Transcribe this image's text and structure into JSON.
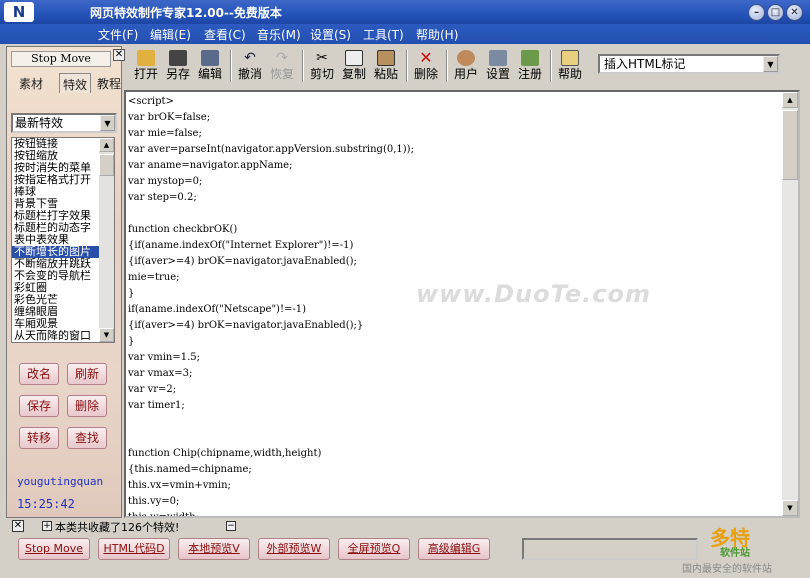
{
  "window": {
    "title": "网页特效制作专家12.00--免费版本",
    "logo": "N"
  },
  "menu": [
    "文件(F)",
    "编辑(E)",
    "查看(C)",
    "音乐(M)",
    "设置(S)",
    "工具(T)",
    "帮助(H)"
  ],
  "left": {
    "stop_move": "Stop Move",
    "tabs": [
      "素材",
      "特效",
      "教程"
    ],
    "category": "最新特效",
    "items": [
      "按钮链接",
      "按钮缩放",
      "按时消失的菜单",
      "按指定格式打开",
      "棒球",
      "背景下雪",
      "标题栏打字效果",
      "标题栏的动态字",
      "表中表效果",
      "不断增长的图片",
      "不断缩放并跳跃",
      "不会变的导航栏",
      "彩虹圈",
      "彩色光芒",
      "缠绵眼眉",
      "车厢观景",
      "从天而降的窗口"
    ],
    "selected_index": 9,
    "buttons": [
      "改名",
      "刷新",
      "保存",
      "删除",
      "转移",
      "查找"
    ],
    "user": "yougutingquan",
    "time": "15:25:42"
  },
  "toolbar": {
    "buttons": [
      "打开",
      "另存",
      "编辑",
      "撤消",
      "恢复",
      "剪切",
      "复制",
      "粘贴",
      "删除",
      "用户",
      "设置",
      "注册",
      "帮助"
    ],
    "insert_combo": "插入HTML标记"
  },
  "editor": {
    "code": "<script>\nvar brOK=false;\nvar mie=false;\nvar aver=parseInt(navigator.appVersion.substring(0,1));\nvar aname=navigator.appName;\nvar mystop=0;\nvar step=0.2;\n\nfunction checkbrOK()\n{if(aname.indexOf(\"Internet Explorer\")!=-1)\n{if(aver>=4) brOK=navigator.javaEnabled();\nmie=true;\n}\nif(aname.indexOf(\"Netscape\")!=-1)\n{if(aver>=4) brOK=navigator.javaEnabled();}\n}\nvar vmin=1.5;\nvar vmax=3;\nvar vr=2;\nvar timer1;\n\n\nfunction Chip(chipname,width,height)\n{this.named=chipname;\nthis.vx=vmin+vmin;\nthis.vy=0;\nthis.w=width;",
    "watermark": "www.DuoTe.com"
  },
  "bottom": {
    "count_text": "本类共收藏了126个特效!",
    "buttons": [
      "Stop Move",
      "HTML代码D",
      "本地预览V",
      "外部预览W",
      "全屏预览Q",
      "高级编辑G"
    ],
    "brand_big": "多特",
    "brand_small": "软件站",
    "brand_sub": "国内最安全的软件站"
  }
}
